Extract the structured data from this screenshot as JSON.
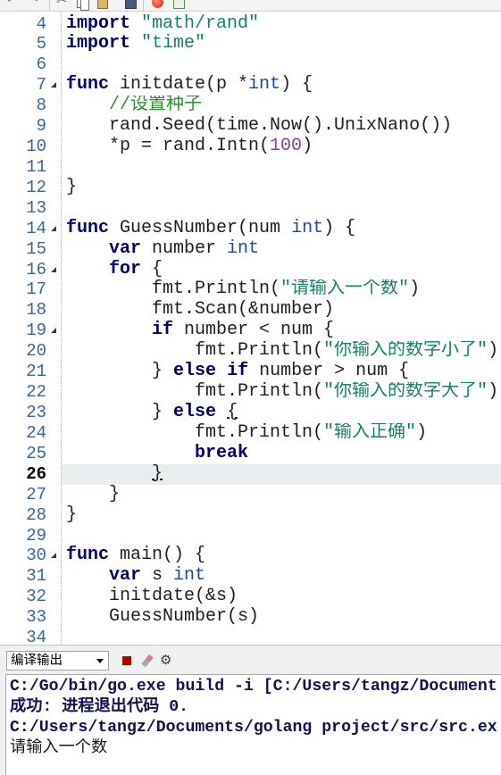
{
  "toolbar": {
    "icons": [
      "undo-icon",
      "redo-icon",
      "cut-icon",
      "copy-icon",
      "paste-icon",
      "save-icon",
      "run-icon",
      "build-icon"
    ]
  },
  "colors": {
    "keyword": "#00006e",
    "type": "#28488c",
    "string": "#17806a",
    "comment": "#2d8f2d",
    "number": "#8e3c9e",
    "plain": "#1e1e1e",
    "line_number": "#3465a4",
    "current_line": "#e8eded",
    "fold_guide": "#8fc08f",
    "stop": "#b80000",
    "output_text": "#121252"
  },
  "editor": {
    "lines": [
      {
        "num": "4",
        "code": [
          {
            "kw": "import"
          },
          {
            "p": " "
          },
          {
            "str": "\"math/rand\""
          }
        ]
      },
      {
        "num": "5",
        "code": [
          {
            "kw": "import"
          },
          {
            "p": " "
          },
          {
            "str": "\"time\""
          }
        ]
      },
      {
        "num": "6",
        "code": []
      },
      {
        "num": "7",
        "fold": true,
        "code": [
          {
            "kw": "func"
          },
          {
            "p": " initdate(p *"
          },
          {
            "ty": "int"
          },
          {
            "p": ") {"
          }
        ]
      },
      {
        "num": "8",
        "code": [
          {
            "p": "    "
          },
          {
            "cm": "//设置种子"
          }
        ]
      },
      {
        "num": "9",
        "code": [
          {
            "p": "    rand.Seed(time.Now().UnixNano())"
          }
        ]
      },
      {
        "num": "10",
        "code": [
          {
            "p": "    *p = rand.Intn("
          },
          {
            "num": "100"
          },
          {
            "p": ")"
          }
        ]
      },
      {
        "num": "11",
        "code": []
      },
      {
        "num": "12",
        "code": [
          {
            "p": "}"
          }
        ]
      },
      {
        "num": "13",
        "code": []
      },
      {
        "num": "14",
        "fold": true,
        "code": [
          {
            "kw": "func"
          },
          {
            "p": " GuessNumber(num "
          },
          {
            "ty": "int"
          },
          {
            "p": ") {"
          }
        ]
      },
      {
        "num": "15",
        "code": [
          {
            "p": "    "
          },
          {
            "kw": "var"
          },
          {
            "p": " number "
          },
          {
            "ty": "int"
          }
        ]
      },
      {
        "num": "16",
        "fold": true,
        "code": [
          {
            "p": "    "
          },
          {
            "kw": "for"
          },
          {
            "p": " {"
          }
        ]
      },
      {
        "num": "17",
        "code": [
          {
            "p": "        fmt.Println("
          },
          {
            "str": "\"请输入一个数\""
          },
          {
            "p": ")"
          }
        ]
      },
      {
        "num": "18",
        "code": [
          {
            "p": "        fmt.Scan(&number)"
          }
        ]
      },
      {
        "num": "19",
        "fold": true,
        "code": [
          {
            "p": "        "
          },
          {
            "kw": "if"
          },
          {
            "p": " number < num {"
          }
        ]
      },
      {
        "num": "20",
        "code": [
          {
            "p": "            fmt.Println("
          },
          {
            "str": "\"你输入的数字小了\""
          },
          {
            "p": ")"
          }
        ]
      },
      {
        "num": "21",
        "code": [
          {
            "p": "        } "
          },
          {
            "kw": "else"
          },
          {
            "p": " "
          },
          {
            "kw": "if"
          },
          {
            "p": " number > num {"
          }
        ]
      },
      {
        "num": "22",
        "code": [
          {
            "p": "            fmt.Println("
          },
          {
            "str": "\"你输入的数字大了\""
          },
          {
            "p": ")"
          }
        ]
      },
      {
        "num": "23",
        "code": [
          {
            "p": "        } "
          },
          {
            "kw": "else"
          },
          {
            "p": " "
          },
          {
            "bm": "{"
          }
        ]
      },
      {
        "num": "24",
        "code": [
          {
            "p": "            fmt.Println("
          },
          {
            "str": "\"输入正确\""
          },
          {
            "p": ")"
          }
        ]
      },
      {
        "num": "25",
        "code": [
          {
            "p": "            "
          },
          {
            "kw": "break"
          }
        ]
      },
      {
        "num": "26",
        "current": true,
        "code": [
          {
            "p": "        "
          },
          {
            "bm": "}"
          }
        ]
      },
      {
        "num": "27",
        "code": [
          {
            "p": "    }"
          }
        ]
      },
      {
        "num": "28",
        "code": [
          {
            "p": "}"
          }
        ]
      },
      {
        "num": "29",
        "code": []
      },
      {
        "num": "30",
        "fold": true,
        "code": [
          {
            "kw": "func"
          },
          {
            "p": " main() {"
          }
        ]
      },
      {
        "num": "31",
        "code": [
          {
            "p": "    "
          },
          {
            "kw": "var"
          },
          {
            "p": " s "
          },
          {
            "ty": "int"
          }
        ]
      },
      {
        "num": "32",
        "code": [
          {
            "p": "    initdate(&s)"
          }
        ]
      },
      {
        "num": "33",
        "code": [
          {
            "p": "    GuessNumber(s)"
          }
        ]
      },
      {
        "num": "34",
        "code": []
      }
    ]
  },
  "output_panel": {
    "selector": {
      "value": "编译输出"
    },
    "icons": [
      "stop-icon",
      "clear-icon",
      "settings-icon"
    ],
    "lines": [
      "C:/Go/bin/go.exe build -i [C:/Users/tangz/Document",
      "成功: 进程退出代码 0.",
      "C:/Users/tangz/Documents/golang project/src/src.ex",
      "请输入一个数"
    ]
  }
}
